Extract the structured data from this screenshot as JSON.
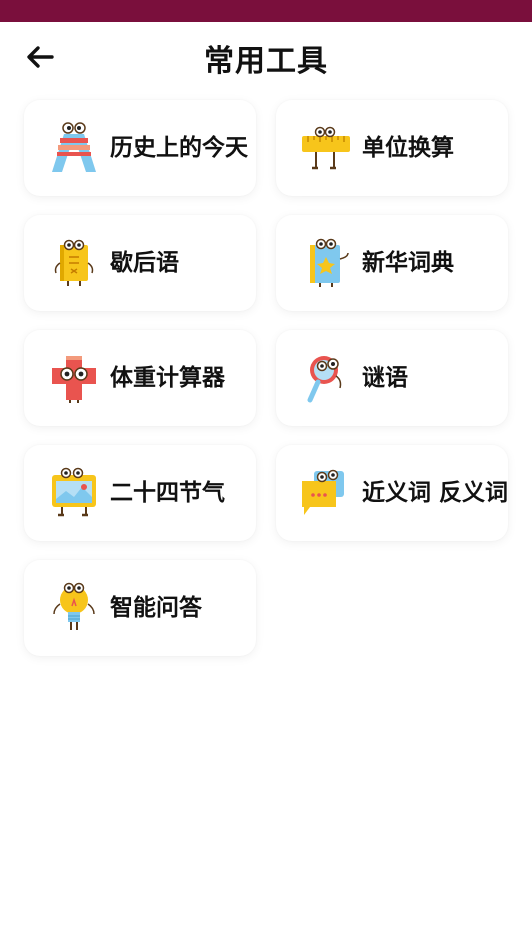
{
  "header": {
    "title": "常用工具",
    "back_icon": "arrow-left-icon"
  },
  "colors": {
    "status_bar": "#7a0f3c",
    "accent_yellow": "#f7c51b",
    "accent_red": "#e9544f",
    "accent_blue": "#7fc8ee"
  },
  "tools": [
    {
      "label": "历史上的今天",
      "icon": "history-today-icon"
    },
    {
      "label": "单位换算",
      "icon": "unit-convert-icon"
    },
    {
      "label": "歇后语",
      "icon": "saying-book-icon"
    },
    {
      "label": "新华词典",
      "icon": "dictionary-icon"
    },
    {
      "label": "体重计算器",
      "icon": "weight-calculator-icon"
    },
    {
      "label": "谜语",
      "icon": "riddle-magnifier-icon"
    },
    {
      "label": "二十四节气",
      "icon": "solar-terms-icon"
    },
    {
      "label": "近义词 反义词",
      "icon": "synonym-antonym-icon"
    },
    {
      "label": "智能问答",
      "icon": "smart-qa-bulb-icon"
    }
  ]
}
